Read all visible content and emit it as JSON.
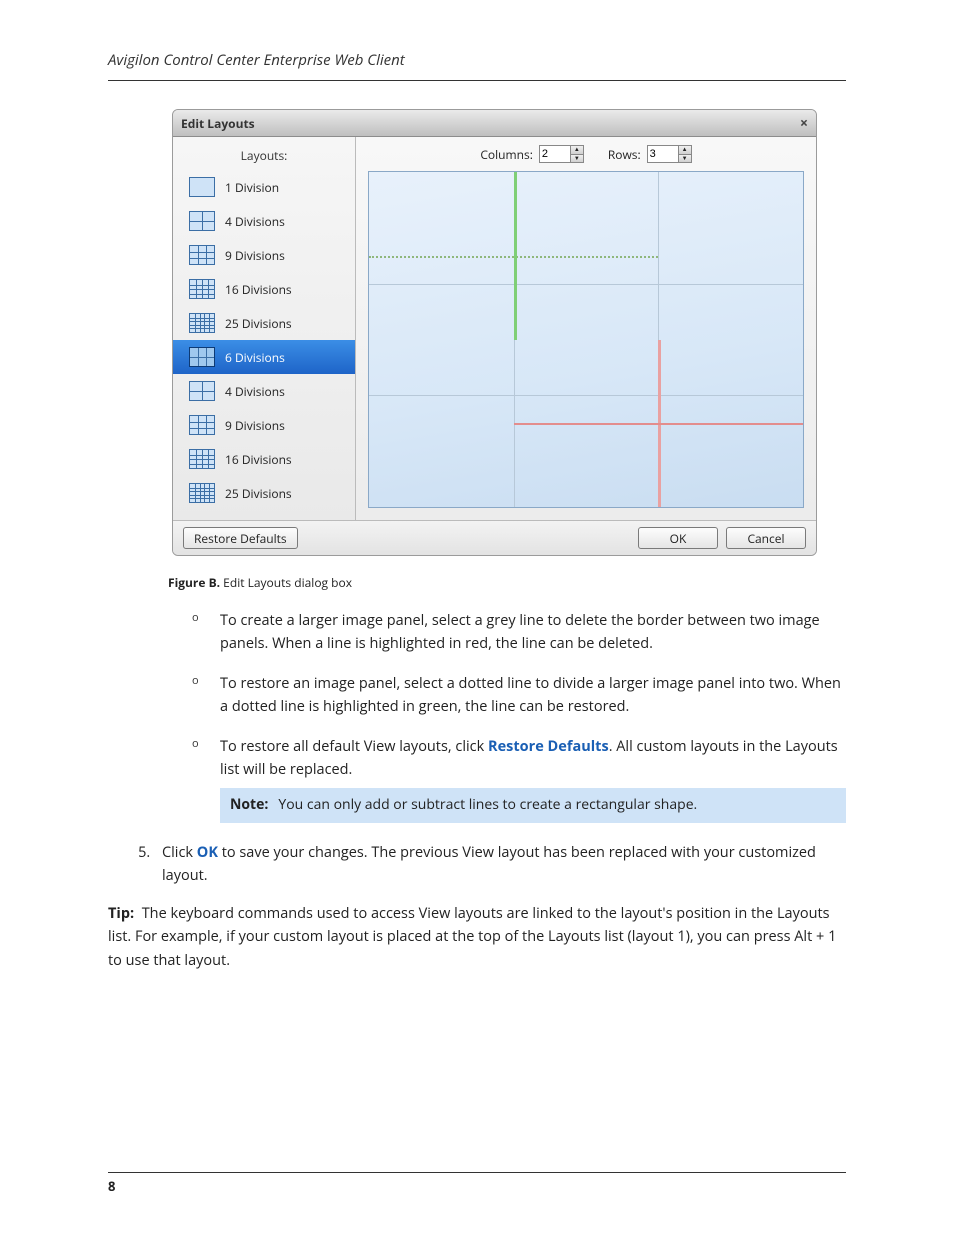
{
  "header": "Avigilon Control Center Enterprise Web Client",
  "page_number": "8",
  "dialog": {
    "title": "Edit Layouts",
    "close_glyph": "×",
    "sidebar_header": "Layouts:",
    "items": [
      {
        "label": "1 Division",
        "grid": "1"
      },
      {
        "label": "4 Divisions",
        "grid": "2"
      },
      {
        "label": "9 Divisions",
        "grid": "3"
      },
      {
        "label": "16 Divisions",
        "grid": "4"
      },
      {
        "label": "25 Divisions",
        "grid": "5"
      },
      {
        "label": "6 Divisions",
        "grid": "6sel"
      },
      {
        "label": "4 Divisions",
        "grid": "2"
      },
      {
        "label": "9 Divisions",
        "grid": "3"
      },
      {
        "label": "16 Divisions",
        "grid": "4"
      },
      {
        "label": "25 Divisions",
        "grid": "5"
      }
    ],
    "columns_label": "Columns:",
    "columns_value": "2",
    "rows_label": "Rows:",
    "rows_value": "3",
    "restore_btn": "Restore Defaults",
    "ok_btn": "OK",
    "cancel_btn": "Cancel"
  },
  "figure_caption_bold": "Figure B.",
  "figure_caption_rest": " Edit Layouts dialog box",
  "bullets": {
    "b1": "To create a larger image panel, select a grey line to delete the border between two image panels. When a line is highlighted in red, the line can be deleted.",
    "b2": "To restore an image panel, select a dotted line to divide a larger image panel into two. When a dotted line is highlighted in green, the line can be restored.",
    "b3a": "To restore all default View layouts, click ",
    "b3_link": "Restore Defaults",
    "b3b": ". All custom layouts in the Layouts list will be replaced."
  },
  "note_label": "Note:",
  "note_text": "You can only add or subtract lines to create a rectangular shape.",
  "step5_num": "5.",
  "step5a": "Click ",
  "step5_link": "OK",
  "step5b": " to save your changes. The previous View layout has been replaced with your customized layout.",
  "tip_label": "Tip:",
  "tip_text": "The keyboard commands used to access View layouts are linked to the layout's position in the Layouts list. For example, if your custom layout is placed at the top of the Layouts list (layout 1), you can press Alt + 1 to use that layout."
}
